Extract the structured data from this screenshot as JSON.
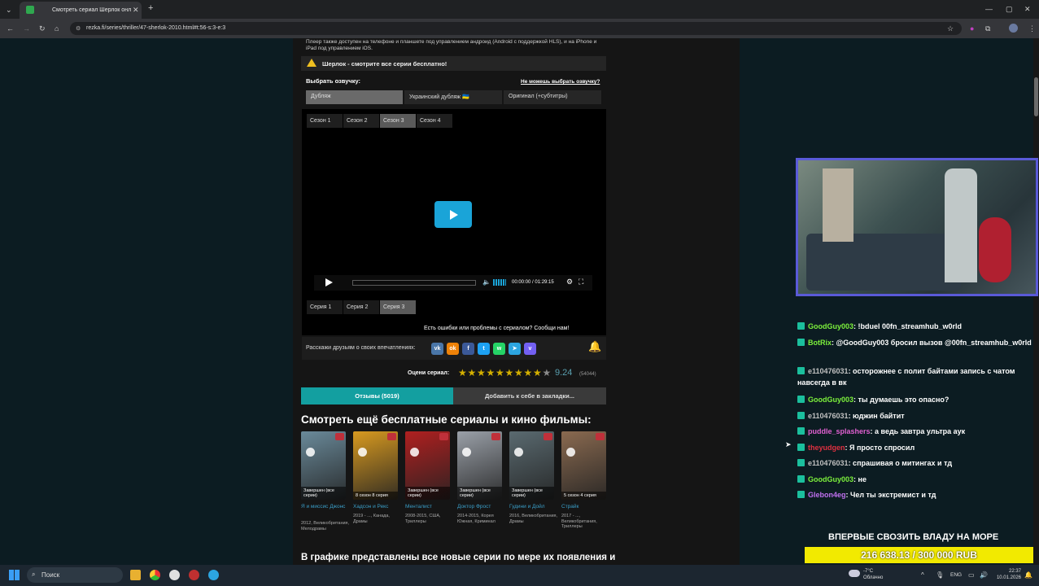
{
  "browser": {
    "tab_title": "Смотреть сериал Шерлок онл",
    "url": "rezka.fi/series/thriller/47-sherlok-2010.html#t:56-s:3-e:3",
    "new_tab": "+"
  },
  "page": {
    "player_note": "Плеер также доступен на телефоне и планшете под управлением андроид (Android с поддержкой HLS), и на iPhone и iPad под управлением iOS.",
    "warning": "Шерлок - смотрите все серии бесплатно!",
    "voice_label": "Выбрать озвучку:",
    "voice_help": "Не можешь выбрать озвучку?",
    "voices": [
      "Дубляж",
      "Украинский дубляж 🇺🇦",
      "Оригинал (+субтитры)"
    ],
    "seasons": [
      "Сезон 1",
      "Сезон 2",
      "Сезон 3",
      "Сезон 4"
    ],
    "episodes": [
      "Серия 1",
      "Серия 2",
      "Серия 3"
    ],
    "time_current": "00:00:00",
    "time_sep": "/",
    "time_total": "01:29:15",
    "report": "Есть ошибки или проблемы с сериалом? Сообщи нам!",
    "share_label": "Расскажи друзьям о своих впечатлениях:",
    "rating_label": "Оцени сериал:",
    "rating_value": "9.24",
    "rating_count": "(54044)",
    "reviews_btn": "Отзывы (5019)",
    "bookmark_btn": "Добавить к себе в закладки...",
    "more_heading": "Смотреть ещё бесплатные сериалы и кино фильмы:",
    "schedule_heading": "В графике представлены все новые серии по мере их появления и",
    "colors": {
      "accent": "#139fa0",
      "play": "#1aa4d8",
      "star": "#d4b000"
    }
  },
  "social": [
    {
      "name": "vk-icon",
      "glyph": "vk",
      "color": "#4a76a8"
    },
    {
      "name": "ok-icon",
      "glyph": "ok",
      "color": "#ee8208"
    },
    {
      "name": "facebook-icon",
      "glyph": "f",
      "color": "#3b5998"
    },
    {
      "name": "twitter-icon",
      "glyph": "t",
      "color": "#1da1f2"
    },
    {
      "name": "whatsapp-icon",
      "glyph": "w",
      "color": "#25d366"
    },
    {
      "name": "telegram-icon",
      "glyph": "➤",
      "color": "#2ca5e0"
    },
    {
      "name": "viber-icon",
      "glyph": "v",
      "color": "#7360f2"
    }
  ],
  "recommendations": [
    {
      "badge": "Завершен (все серии)",
      "title": "Я и миссис Джонс",
      "meta": "2012, Великобритания, Мелодрамы",
      "color": "#6a8a9a"
    },
    {
      "badge": "8 сезон 8 серия",
      "title": "Хадсон и Рекс",
      "meta": "2019 - ..., Канада, Драмы",
      "color": "#d89a20"
    },
    {
      "badge": "Завершен (все серии)",
      "title": "Менталист",
      "meta": "2008-2015, США, Триллеры",
      "color": "#b02020"
    },
    {
      "badge": "Завершен (все серии)",
      "title": "Доктор Фрост",
      "meta": "2014-2015, Корея Южная, Криминал",
      "color": "#9aa0a8"
    },
    {
      "badge": "Завершен (все серии)",
      "title": "Гудини и Дойл",
      "meta": "2016, Великобритания, Драмы",
      "color": "#5a6a70"
    },
    {
      "badge": "5 сезон 4 серия",
      "title": "Страйк",
      "meta": "2017 - ..., Великобритания, Триллеры",
      "color": "#8a6a50"
    }
  ],
  "chat": [
    {
      "user": "GoodGuy003",
      "color": "#7cf03c",
      "text": ": !bduel 00fn_streamhub_w0rld"
    },
    {
      "user": "BotRix",
      "color": "#7cf03c",
      "text": ": @GoodGuy003 бросил вызов @00fn_streamhub_w0rld"
    },
    {
      "user": "e110476031",
      "color": "#c0c0c0",
      "text": ": осторожнее с полит байтами запись с чатом навсегда в вк"
    },
    {
      "user": "GoodGuy003",
      "color": "#7cf03c",
      "text": ": ты думаешь это опасно?"
    },
    {
      "user": "e110476031",
      "color": "#c0c0c0",
      "text": ": юджин байтит"
    },
    {
      "user": "puddle_splashers",
      "color": "#e060d0",
      "text": ": а ведь завтра ультра аук"
    },
    {
      "user": "theyudgen",
      "color": "#e03040",
      "text": ": Я просто спросил"
    },
    {
      "user": "e110476031",
      "color": "#c0c0c0",
      "text": ": спрашивая о митингах и тд"
    },
    {
      "user": "GoodGuy003",
      "color": "#7cf03c",
      "text": ": не"
    },
    {
      "user": "Glebon4eg",
      "color": "#c070f0",
      "text": ": Чел ты экстремист и тд"
    }
  ],
  "stream": {
    "banner": "ВПЕРВЫЕ СВОЗИТЬ ВЛАДУ НА МОРЕ",
    "goal": "216 638.13 / 300 000 RUB"
  },
  "taskbar": {
    "search": "Поиск",
    "weather_temp": "-7°C",
    "weather_text": "Облачно",
    "lang": "ENG",
    "time": "22:37",
    "date": "10.01.2026"
  }
}
